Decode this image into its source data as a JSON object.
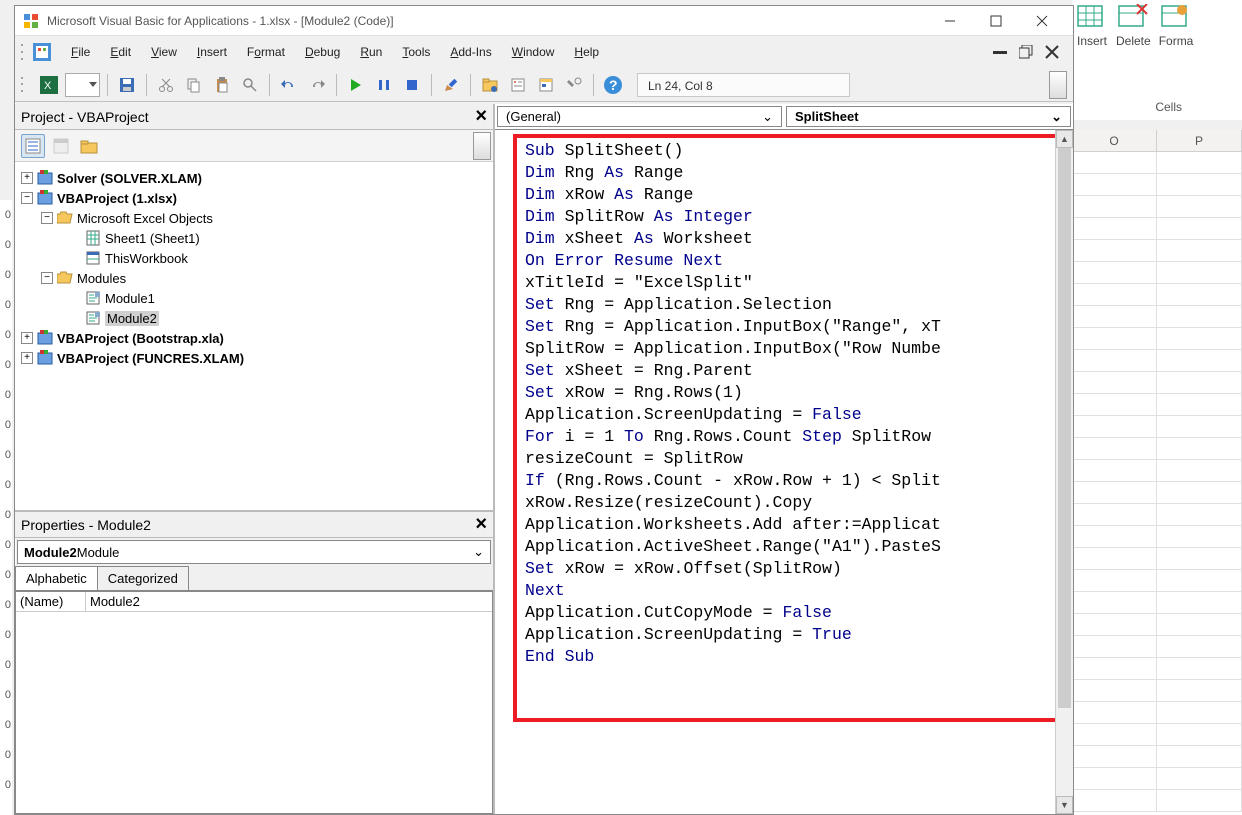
{
  "excel_ribbon": {
    "insert": "Insert",
    "delete": "Delete",
    "format": "Forma",
    "cells_group": "Cells",
    "cols": [
      "O",
      "P"
    ]
  },
  "titlebar": {
    "text": "Microsoft Visual Basic for Applications - 1.xlsx - [Module2 (Code)]"
  },
  "menu": {
    "file": "File",
    "edit": "Edit",
    "view": "View",
    "insert": "Insert",
    "format": "Format",
    "debug": "Debug",
    "run": "Run",
    "tools": "Tools",
    "addins": "Add-Ins",
    "window": "Window",
    "help": "Help"
  },
  "toolbar": {
    "status": "Ln 24, Col 8"
  },
  "project_panel": {
    "title": "Project - VBAProject"
  },
  "tree": {
    "solver": "Solver (SOLVER.XLAM)",
    "vbaproj": "VBAProject (1.xlsx)",
    "mseo": "Microsoft Excel Objects",
    "sheet1": "Sheet1 (Sheet1)",
    "thiswb": "ThisWorkbook",
    "modules": "Modules",
    "module1": "Module1",
    "module2": "Module2",
    "bootstrap": "VBAProject (Bootstrap.xla)",
    "funcres": "VBAProject (FUNCRES.XLAM)"
  },
  "properties_panel": {
    "title": "Properties - Module2"
  },
  "props": {
    "combo_label_bold": "Module2",
    "combo_label_rest": " Module",
    "tab_alpha": "Alphabetic",
    "tab_cat": "Categorized",
    "row_name": "(Name)",
    "row_value": "Module2"
  },
  "code_dd": {
    "left": "(General)",
    "right": "SplitSheet"
  },
  "code": {
    "lines": [
      {
        "t": "kw",
        "v": "Sub"
      },
      {
        "t": "p",
        "v": " SplitSheet()\n"
      },
      {
        "t": "kw",
        "v": "Dim"
      },
      {
        "t": "p",
        "v": " Rng "
      },
      {
        "t": "kw",
        "v": "As"
      },
      {
        "t": "p",
        "v": " Range\n"
      },
      {
        "t": "kw",
        "v": "Dim"
      },
      {
        "t": "p",
        "v": " xRow "
      },
      {
        "t": "kw",
        "v": "As"
      },
      {
        "t": "p",
        "v": " Range\n"
      },
      {
        "t": "kw",
        "v": "Dim"
      },
      {
        "t": "p",
        "v": " SplitRow "
      },
      {
        "t": "kw",
        "v": "As"
      },
      {
        "t": "p",
        "v": " "
      },
      {
        "t": "kw",
        "v": "Integer"
      },
      {
        "t": "p",
        "v": "\n"
      },
      {
        "t": "kw",
        "v": "Dim"
      },
      {
        "t": "p",
        "v": " xSheet "
      },
      {
        "t": "kw",
        "v": "As"
      },
      {
        "t": "p",
        "v": " Worksheet\n"
      },
      {
        "t": "kw",
        "v": "On Error Resume Next"
      },
      {
        "t": "p",
        "v": "\n"
      },
      {
        "t": "p",
        "v": "xTitleId = \"ExcelSplit\"\n"
      },
      {
        "t": "kw",
        "v": "Set"
      },
      {
        "t": "p",
        "v": " Rng = Application.Selection\n"
      },
      {
        "t": "kw",
        "v": "Set"
      },
      {
        "t": "p",
        "v": " Rng = Application.InputBox(\"Range\", xT\n"
      },
      {
        "t": "p",
        "v": "SplitRow = Application.InputBox(\"Row Numbe\n"
      },
      {
        "t": "kw",
        "v": "Set"
      },
      {
        "t": "p",
        "v": " xSheet = Rng.Parent\n"
      },
      {
        "t": "kw",
        "v": "Set"
      },
      {
        "t": "p",
        "v": " xRow = Rng.Rows(1)\n"
      },
      {
        "t": "p",
        "v": "Application.ScreenUpdating = "
      },
      {
        "t": "kw",
        "v": "False"
      },
      {
        "t": "p",
        "v": "\n"
      },
      {
        "t": "kw",
        "v": "For"
      },
      {
        "t": "p",
        "v": " i = 1 "
      },
      {
        "t": "kw",
        "v": "To"
      },
      {
        "t": "p",
        "v": " Rng.Rows.Count "
      },
      {
        "t": "kw",
        "v": "Step"
      },
      {
        "t": "p",
        "v": " SplitRow\n"
      },
      {
        "t": "p",
        "v": "resizeCount = SplitRow\n"
      },
      {
        "t": "kw",
        "v": "If"
      },
      {
        "t": "p",
        "v": " (Rng.Rows.Count - xRow.Row + 1) < Split\n"
      },
      {
        "t": "p",
        "v": "xRow.Resize(resizeCount).Copy\n"
      },
      {
        "t": "p",
        "v": "Application.Worksheets.Add after:=Applicat\n"
      },
      {
        "t": "p",
        "v": "Application.ActiveSheet.Range(\"A1\").PasteS\n"
      },
      {
        "t": "kw",
        "v": "Set"
      },
      {
        "t": "p",
        "v": " xRow = xRow.Offset(SplitRow)\n"
      },
      {
        "t": "kw",
        "v": "Next"
      },
      {
        "t": "p",
        "v": "\n"
      },
      {
        "t": "p",
        "v": "Application.CutCopyMode = "
      },
      {
        "t": "kw",
        "v": "False"
      },
      {
        "t": "p",
        "v": "\n"
      },
      {
        "t": "p",
        "v": "Application.ScreenUpdating = "
      },
      {
        "t": "kw",
        "v": "True"
      },
      {
        "t": "p",
        "v": "\n"
      },
      {
        "t": "kw",
        "v": "End Sub"
      }
    ]
  }
}
